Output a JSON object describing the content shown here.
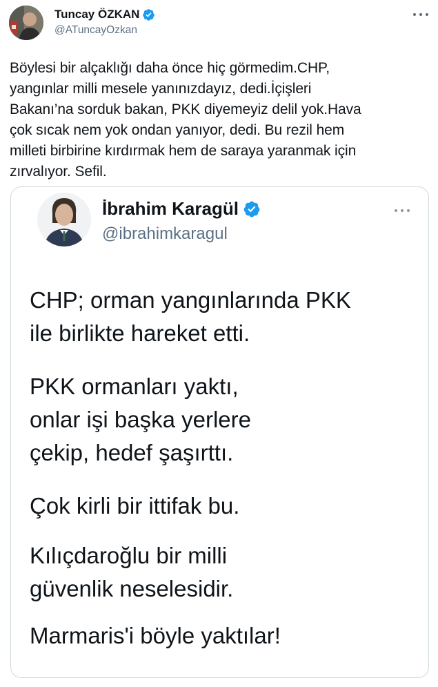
{
  "tweet": {
    "author_name": "Tuncay ÖZKAN",
    "author_handle": "@ATuncayOzkan",
    "text": "Böylesi bir alçaklığı daha önce hiç görmedim.CHP,\nyangınlar milli mesele yanınızdayız, dedi.İçişleri\nBakanı’na sorduk bakan, PKK diyemeyiz delil yok.Hava\nçok sıcak nem yok ondan yanıyor, dedi. Bu rezil hem\nmilleti birbirine kırdırmak hem de saraya yaranmak için\nzırvalıyor. Sefil."
  },
  "quoted": {
    "author_name": "İbrahim Karagül",
    "author_handle": "@ibrahimkaragul",
    "paragraphs": [
      "CHP; orman yangınlarında PKK\nile birlikte hareket etti.",
      "PKK ormanları yaktı,\nonlar işi başka yerlere\nçekip, hedef şaşırttı.",
      "Çok kirli bir ittifak bu.",
      "Kılıçdaroğlu bir milli\ngüvenlik neselesidir.",
      "Marmaris'i böyle yaktılar!"
    ]
  },
  "icons": {
    "verified": "verified-badge-icon",
    "more": "more-options-icon"
  },
  "colors": {
    "text": "#0f1419",
    "secondary": "#5b7083",
    "verified": "#1d9bf0",
    "border": "#cfd9de"
  }
}
